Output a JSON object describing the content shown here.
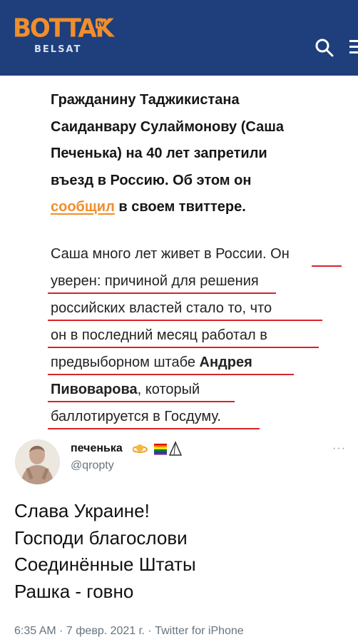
{
  "header": {
    "logo_main": "BOTTAK",
    "logo_tv": "tv",
    "logo_sub": "BELSAT",
    "icons": [
      "search-icon",
      "menu-icon"
    ],
    "colors": {
      "brand_blue": "#1e3f7c",
      "brand_orange": "#f18e2b"
    }
  },
  "article": {
    "lead_part1": "Гражданину Таджикистана Саиданвару Сулаймонову (Саша Печенька) на 40 лет запретили въезд в Россию. Об этом он",
    "lead_link": "сообщил",
    "lead_part2": "в своем твиттере.",
    "body_lines": [
      "Саша много лет живет в России. Он",
      "уверен: причиной для решения",
      "российских властей стало то, что",
      "он в последний месяц работал в",
      "предвыборном штабе",
      "Андрея",
      "Пивоварова",
      ", который",
      "баллотируется в Госдуму."
    ],
    "annotation_color": "#d8232a"
  },
  "tweet": {
    "display_name": "печенька",
    "handle": "@qropty",
    "more": "···",
    "lines": [
      "Слава Украине!",
      "Господи благослови",
      "Соединённые Штаты",
      "Рашка - говно"
    ],
    "meta": "6:35 AM · 7 февр. 2021 г. · Twitter for iPhone"
  }
}
